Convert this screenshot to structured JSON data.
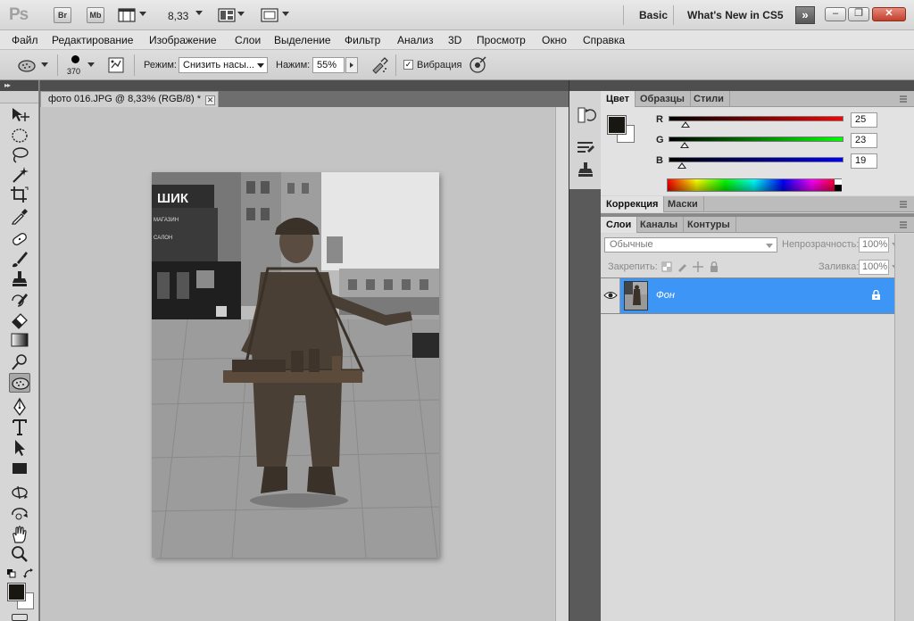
{
  "app": {
    "logo": "Ps",
    "bridge_label": "Br",
    "minibridge_label": "Mb",
    "zoom": "8,33",
    "workspaces": [
      "Basic",
      "What's New in CS5"
    ],
    "more_workspaces": "»",
    "window_buttons": {
      "minimize": "–",
      "restore": "❐",
      "close": "✕"
    }
  },
  "menu": [
    "Файл",
    "Редактирование",
    "Изображение",
    "Слои",
    "Выделение",
    "Фильтр",
    "Анализ",
    "3D",
    "Просмотр",
    "Окно",
    "Справка"
  ],
  "options": {
    "brush_size": "370",
    "mode_label": "Режим:",
    "mode_value": "Снизить насы...",
    "flow_label": "Нажим:",
    "flow_value": "55%",
    "vibrance_checked": "✓",
    "vibrance_label": "Вибрация"
  },
  "toolbox": {
    "collapse_glyph": "▸▸",
    "tools": [
      "move-tool",
      "marquee-tool",
      "lasso-tool",
      "quick-selection-tool",
      "crop-tool",
      "eyedropper-tool",
      "healing-brush-tool",
      "brush-tool",
      "clone-stamp-tool",
      "history-brush-tool",
      "eraser-tool",
      "gradient-tool",
      "blur-tool",
      "sponge-tool",
      "pen-tool",
      "type-tool",
      "path-selection-tool",
      "rectangle-tool",
      "3d-rotate-tool",
      "3d-orbit-tool",
      "hand-tool",
      "zoom-tool"
    ],
    "active_tool": "sponge-tool",
    "foreground_color": "#191712",
    "background_color": "#ffffff"
  },
  "document": {
    "tab_title": "фото 016.JPG @ 8,33% (RGB/8) *",
    "close_glyph": "✕",
    "canvas_color": "#c4c4c4"
  },
  "panels": {
    "color_tabs": [
      "Цвет",
      "Образцы",
      "Стили"
    ],
    "adjust_tabs": [
      "Коррекция",
      "Маски"
    ],
    "layer_tabs": [
      "Слои",
      "Каналы",
      "Контуры"
    ],
    "color": {
      "r_label": "R",
      "r_value": "25",
      "g_label": "G",
      "g_value": "23",
      "b_label": "B",
      "b_value": "19",
      "r_fraction": 0.098,
      "g_fraction": 0.09,
      "b_fraction": 0.075
    },
    "layers": {
      "blend_mode": "Обычные",
      "opacity_label": "Непрозрачность:",
      "opacity_value": "100%",
      "lock_label": "Закрепить:",
      "fill_label": "Заливка:",
      "fill_value": "100%",
      "layer_name": "Фон",
      "layer_color": "#3d96f5"
    }
  }
}
